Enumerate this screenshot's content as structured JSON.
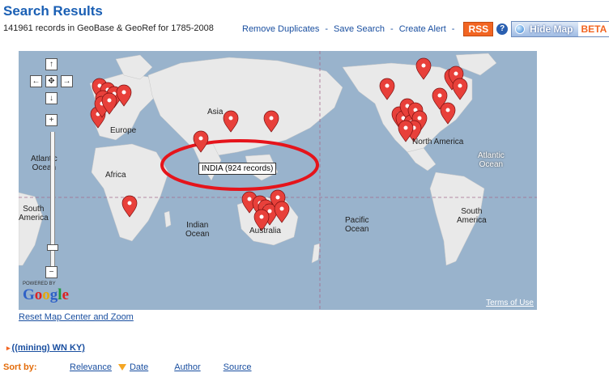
{
  "header": {
    "title": "Search Results",
    "subtitle": "141961 records in GeoBase & GeoRef for 1785-2008"
  },
  "toolbar": {
    "remove_duplicates": "Remove Duplicates",
    "save_search": "Save Search",
    "create_alert": "Create Alert",
    "separator": "-",
    "rss": "RSS",
    "help": "?",
    "hide_map": "Hide Map",
    "beta": "BETA"
  },
  "map": {
    "tooltip": "INDIA (924 records)",
    "labels": {
      "asia": "Asia",
      "europe": "Europe",
      "africa": "Africa",
      "atlantic_ocean_left": "Atlantic\nOcean",
      "south_america_left": "South\nAmerica",
      "indian_ocean": "Indian\nOcean",
      "australia": "Australia",
      "pacific_ocean": "Pacific\nOcean",
      "north_america": "North America",
      "atlantic_ocean_right": "Atlantic\nOcean",
      "south_america_right": "South\nAmerica"
    },
    "powered_by": "POWERED BY",
    "google": "Google",
    "terms": "Terms of Use",
    "highlight_color": "#e5141b",
    "marker_color": "#e8403a",
    "water_color": "#99b3cc",
    "land_color": "#e8e8e8"
  },
  "reset_link": "Reset Map Center and Zoom",
  "query": {
    "text": "((mining) WN KY)"
  },
  "sort": {
    "label": "Sort by:",
    "options": [
      "Relevance",
      "Date",
      "Author",
      "Source"
    ],
    "selected": "Relevance"
  }
}
